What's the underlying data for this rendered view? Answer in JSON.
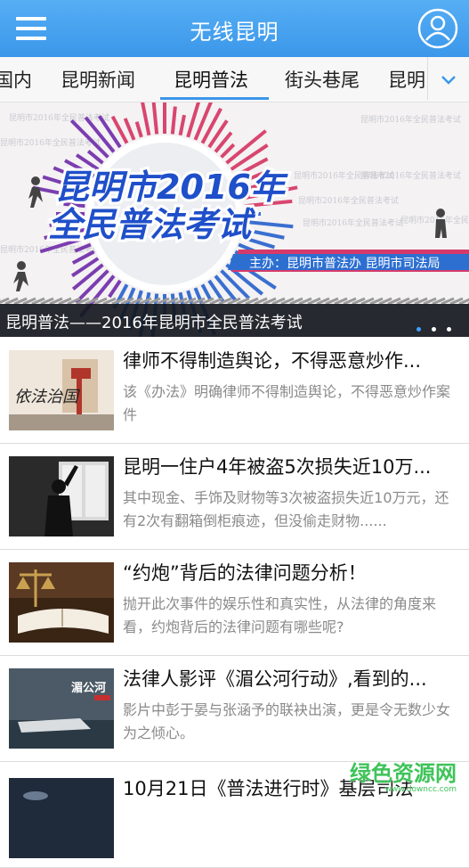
{
  "header": {
    "title": "无线昆明",
    "menu_icon": "menu-icon",
    "user_icon": "user-icon",
    "accent": "#3b97ea"
  },
  "tabs": [
    {
      "label": "国内"
    },
    {
      "label": "昆明新闻"
    },
    {
      "label": "昆明普法",
      "active": true
    },
    {
      "label": "街头巷尾"
    },
    {
      "label": "昆明"
    }
  ],
  "banner": {
    "headline_line1": "昆明市2016年",
    "headline_line2": "全民普法考试",
    "sponsor": "主办：昆明市普法办 昆明市司法局",
    "bg_repeat_text": "昆明市2016年全民普法考试",
    "caption": "昆明普法——2016年昆明市全民普法考试",
    "slide_count": 3,
    "active_slide": 1
  },
  "news": [
    {
      "title": "律师不得制造舆论，不得恶意炒作...",
      "desc": "该《办法》明确律师不得制造舆论，不得恶意炒作案件",
      "thumb_text": "依法治国"
    },
    {
      "title": "昆明一住户4年被盗5次损失近10万...",
      "desc": "其中现金、手饰及财物等3次被盗损失近10万元，还有2次有翻箱倒柜痕迹，但没偷走财物......"
    },
    {
      "title": "“约炮”背后的法律问题分析！",
      "desc": "抛开此次事件的娱乐性和真实性，从法律的角度来看，约炮背后的法律问题有哪些呢?"
    },
    {
      "title": "法律人影评《湄公河行动》,看到的...",
      "desc": "影片中彭于晏与张涵予的联袂出演，更是令无数少女为之倾心。",
      "thumb_text": "湄公河"
    },
    {
      "title": "10月21日《普法进行时》基层司法",
      "desc": ""
    }
  ],
  "watermark": {
    "text": "绿色资源网",
    "sub": "www.downcc.com"
  }
}
